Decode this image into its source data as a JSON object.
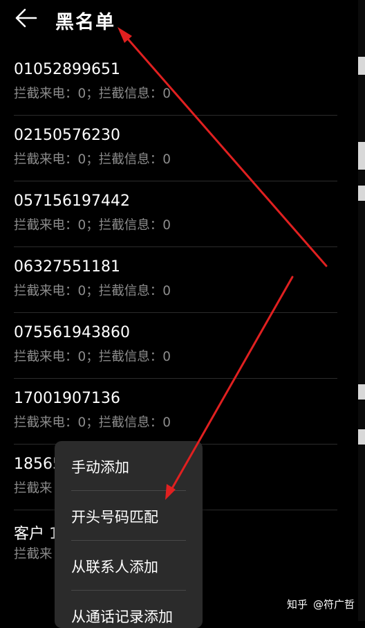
{
  "header": {
    "title": "黑名单",
    "back_icon": "arrow-left-icon"
  },
  "blacklist": [
    {
      "number": "01052899651",
      "stats": "拦截来电：0；拦截信息：0"
    },
    {
      "number": "02150576230",
      "stats": "拦截来电：0；拦截信息：0"
    },
    {
      "number": "057156197442",
      "stats": "拦截来电：0；拦截信息：0"
    },
    {
      "number": "06327551181",
      "stats": "拦截来电：0；拦截信息：0"
    },
    {
      "number": "075561943860",
      "stats": "拦截来电：0；拦截信息：0"
    },
    {
      "number": "17001907136",
      "stats": "拦截来电：0；拦截信息：0"
    },
    {
      "number": "18565",
      "stats": "拦截来"
    },
    {
      "number": "客户 1",
      "stats": "拦截来"
    }
  ],
  "add_menu": {
    "items": [
      "手动添加",
      "开头号码匹配",
      "从联系人添加",
      "从通话记录添加"
    ]
  },
  "watermark": {
    "logo": "知乎",
    "author": "@符广哲"
  },
  "colors": {
    "background": "#000000",
    "menu": "#2b2b2b",
    "annotation_arrow": "#e02020",
    "secondary_text": "#8c8c8c"
  }
}
